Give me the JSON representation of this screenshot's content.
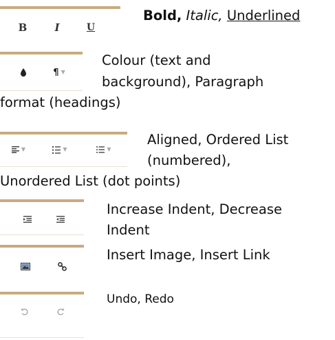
{
  "rows": [
    {
      "buttons": [
        "bold-icon",
        "italic-icon",
        "underline-icon"
      ],
      "desc_parts": {
        "bold": "Bold,",
        "italic": "Italic,",
        "underline": "Underlined"
      }
    },
    {
      "buttons": [
        "color-drop-icon",
        "paragraph-icon"
      ],
      "lines": [
        "Colour (text and",
        "background), Paragraph",
        "format (headings)"
      ]
    },
    {
      "buttons": [
        "align-left-icon",
        "ordered-list-icon",
        "unordered-list-icon"
      ],
      "lines": [
        "Aligned, Ordered List",
        "(numbered),",
        "Unordered List (dot points)"
      ]
    },
    {
      "buttons": [
        "indent-increase-icon",
        "indent-decrease-icon"
      ],
      "lines": [
        "Increase Indent, Decrease",
        "Indent"
      ]
    },
    {
      "buttons": [
        "insert-image-icon",
        "insert-link-icon"
      ],
      "lines": [
        "Insert Image, Insert Link"
      ]
    },
    {
      "buttons": [
        "undo-icon",
        "redo-icon"
      ],
      "lines": [
        "Undo, Redo"
      ]
    }
  ],
  "glyphs": {
    "bold": "B",
    "italic": "I",
    "underline": "U",
    "paragraph": "¶",
    "caret": "▼"
  },
  "colors": {
    "accent_bar": "#c7ab7e",
    "icon": "#555555",
    "text": "#111111"
  }
}
